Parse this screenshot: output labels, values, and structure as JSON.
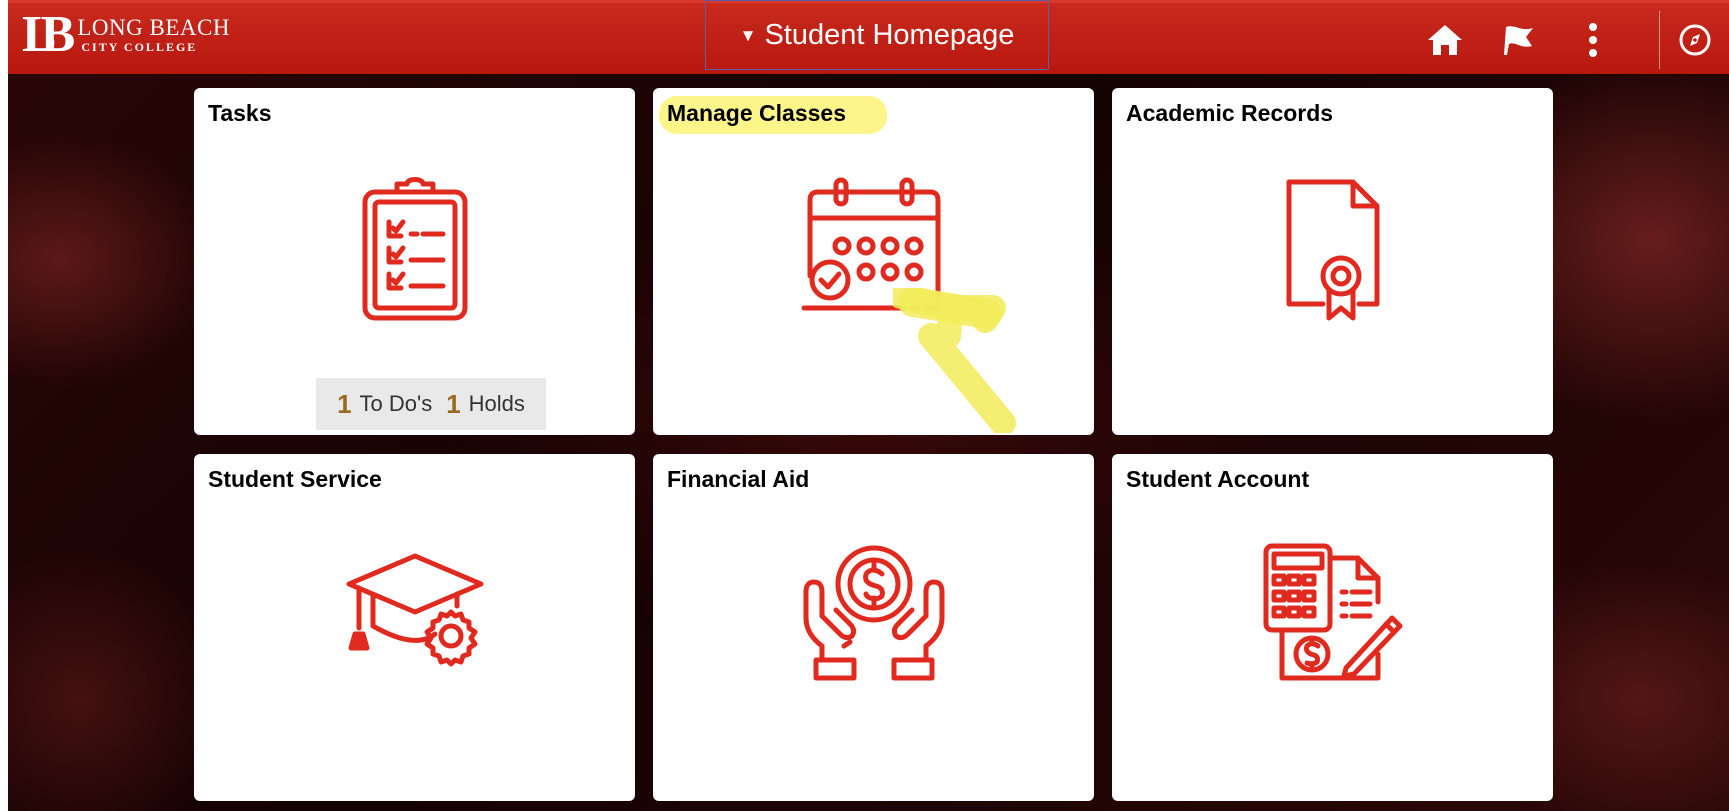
{
  "header": {
    "logo_line1": "LONG BEACH",
    "logo_line2": "CITY COLLEGE",
    "page_title": "Student Homepage",
    "icons": [
      "home-icon",
      "flag-icon",
      "more-options-icon",
      "navigator-icon"
    ]
  },
  "tiles": [
    {
      "title": "Tasks",
      "icon": "clipboard-checklist-icon"
    },
    {
      "title": "Manage Classes",
      "icon": "calendar-check-icon"
    },
    {
      "title": "Academic Records",
      "icon": "certificate-document-icon"
    },
    {
      "title": "Student Service",
      "icon": "graduation-cap-gear-icon"
    },
    {
      "title": "Financial Aid",
      "icon": "hands-dollar-coin-icon"
    },
    {
      "title": "Student Account",
      "icon": "calculator-invoice-icon"
    }
  ],
  "tasks": {
    "todo_count": "1",
    "todo_label": "To Do's",
    "holds_count": "1",
    "holds_label": "Holds"
  },
  "colors": {
    "header": "#b8170e",
    "icon_red": "#e02a1f",
    "highlight": "#fdf58a"
  }
}
